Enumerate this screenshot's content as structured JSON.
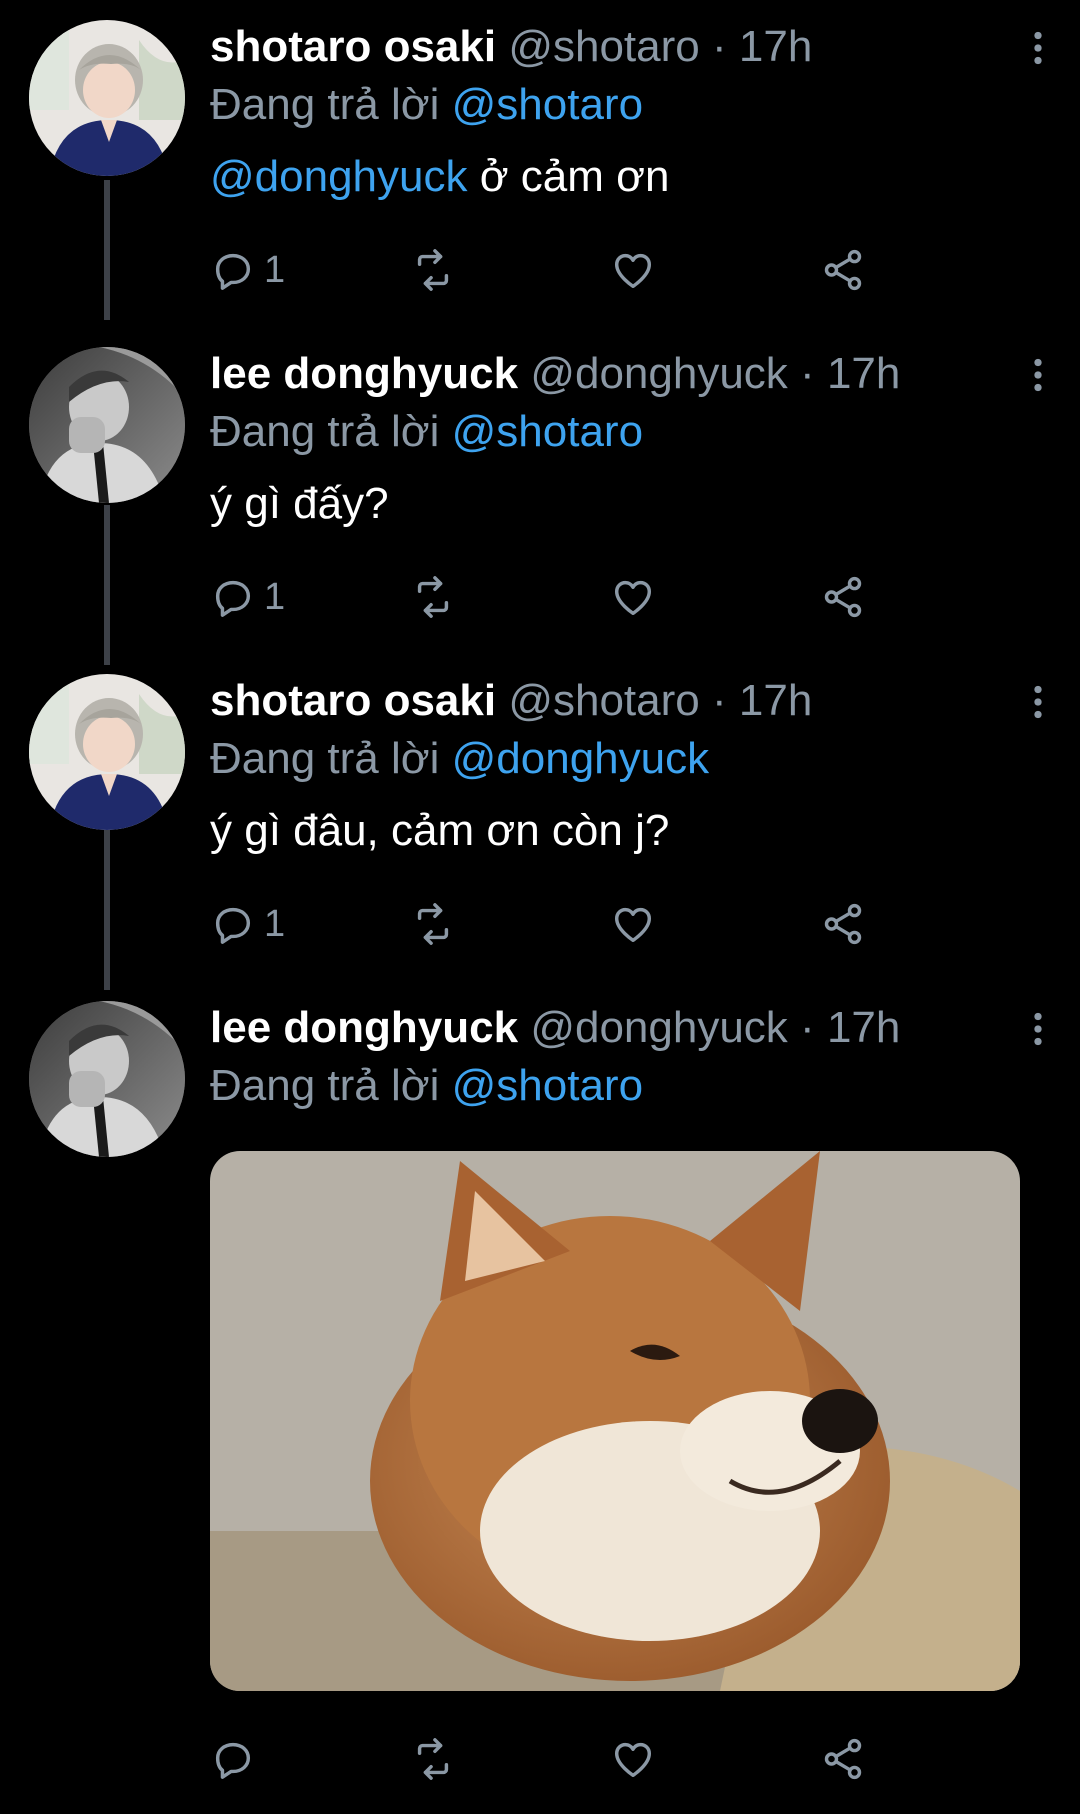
{
  "colors": {
    "background": "#000000",
    "text": "#ffffff",
    "secondary": "#8b98a5",
    "accent": "#3ea3ef",
    "thread_line": "#3d4148"
  },
  "icons": [
    "more-vertical-icon",
    "reply-icon",
    "retweet-icon",
    "like-icon",
    "share-icon"
  ],
  "tweets": [
    {
      "name": "shotaro osaki",
      "handle": "@shotaro",
      "separator": "·",
      "time": "17h",
      "replying_label": "Đang trả lời",
      "replying_to": "@shotaro",
      "mention": "@donghyuck",
      "text": " ở cảm ơn",
      "reply_count": "1",
      "avatar": "shotaro-avatar"
    },
    {
      "name": "lee donghyuck",
      "handle": "@donghyuck",
      "separator": "·",
      "time": "17h",
      "replying_label": "Đang trả lời",
      "replying_to": "@shotaro",
      "text": "ý gì đấy?",
      "reply_count": "1",
      "avatar": "donghyuck-avatar"
    },
    {
      "name": "shotaro osaki",
      "handle": "@shotaro",
      "separator": "·",
      "time": "17h",
      "replying_label": "Đang trả lời",
      "replying_to": "@donghyuck",
      "text": "ý gì đâu, cảm ơn còn j?",
      "reply_count": "1",
      "avatar": "shotaro-avatar"
    },
    {
      "name": "lee donghyuck",
      "handle": "@donghyuck",
      "separator": "·",
      "time": "17h",
      "replying_label": "Đang trả lời",
      "replying_to": "@shotaro",
      "media": "shiba-inu-dog-photo",
      "avatar": "donghyuck-avatar"
    }
  ]
}
